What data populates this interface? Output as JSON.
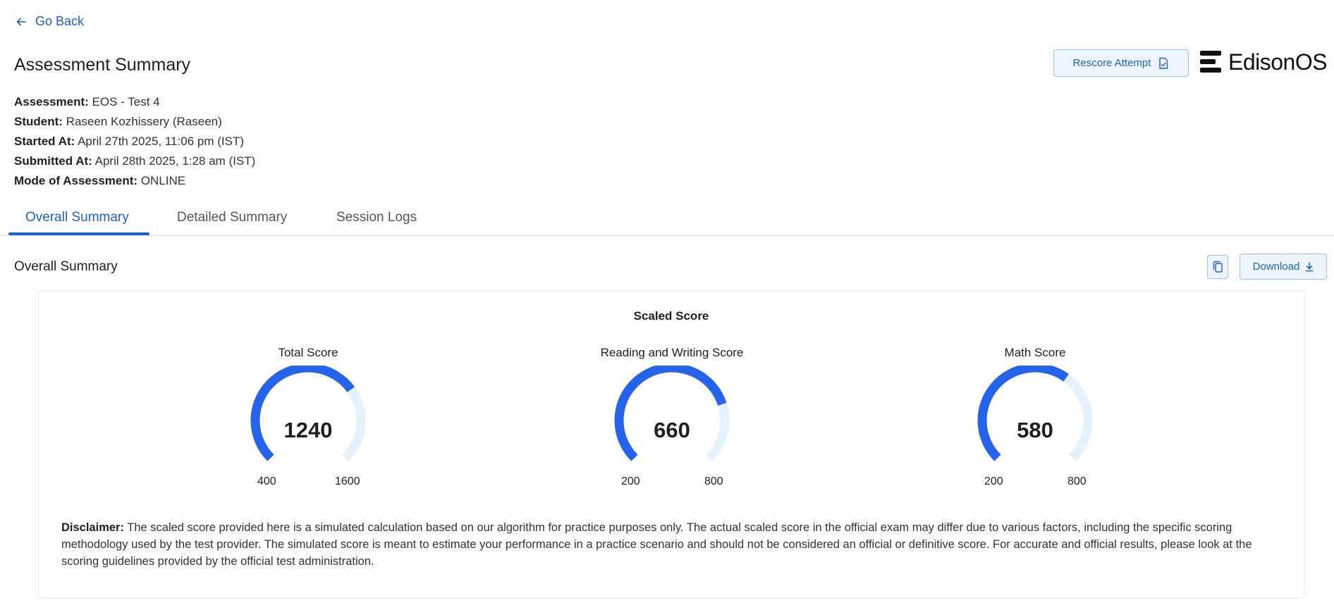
{
  "nav": {
    "go_back": "Go Back"
  },
  "header": {
    "title": "Assessment Summary",
    "rescore_label": "Rescore Attempt",
    "logo_text": "EdisonOS"
  },
  "meta": [
    {
      "label": "Assessment:",
      "value": "EOS - Test 4"
    },
    {
      "label": "Student:",
      "value": "Raseen Kozhissery (Raseen)"
    },
    {
      "label": "Started At:",
      "value": "April 27th 2025, 11:06 pm (IST)"
    },
    {
      "label": "Submitted At:",
      "value": "April 28th 2025, 1:28 am (IST)"
    },
    {
      "label": "Mode of Assessment:",
      "value": "ONLINE"
    }
  ],
  "tabs": [
    {
      "label": "Overall Summary",
      "active": true
    },
    {
      "label": "Detailed Summary",
      "active": false
    },
    {
      "label": "Session Logs",
      "active": false
    }
  ],
  "section": {
    "title": "Overall Summary",
    "download_label": "Download"
  },
  "card": {
    "title": "Scaled Score",
    "gauges": [
      {
        "label": "Total Score",
        "value": 1240,
        "min": 400,
        "max": 1600
      },
      {
        "label": "Reading and Writing Score",
        "value": 660,
        "min": 200,
        "max": 800
      },
      {
        "label": "Math Score",
        "value": 580,
        "min": 200,
        "max": 800
      }
    ],
    "disclaimer_label": "Disclaimer:",
    "disclaimer_text": "The scaled score provided here is a simulated calculation based on our algorithm for practice purposes only. The actual scaled score in the official exam may differ due to various factors, including the specific scoring methodology used by the test provider. The simulated score is meant to estimate your performance in a practice scenario and should not be considered an official or definitive score. For accurate and official results, please look at the scoring guidelines provided by the official test administration."
  },
  "colors": {
    "accent": "#1f5fc4",
    "gauge_fill": "#2563eb",
    "gauge_track": "#e3f2fd"
  }
}
